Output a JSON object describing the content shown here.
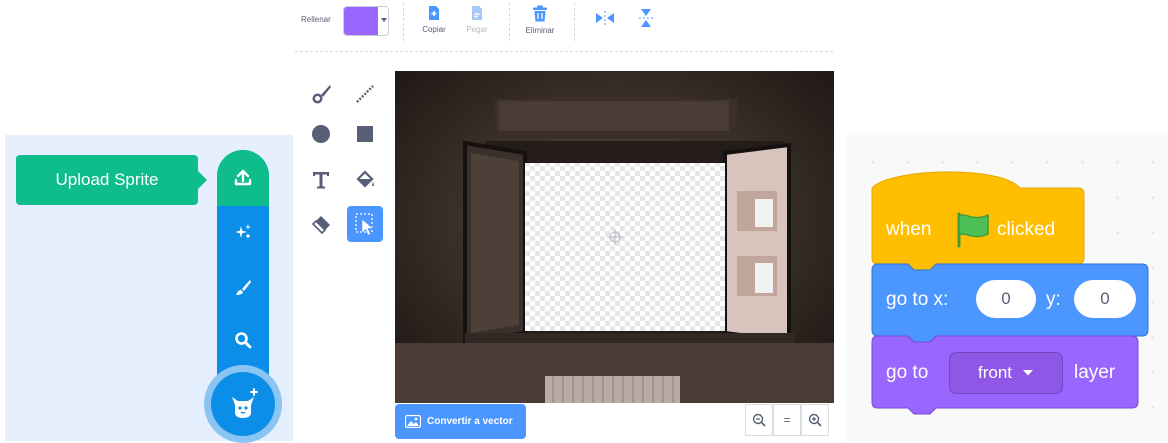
{
  "sprite_menu": {
    "tooltip": "Upload Sprite",
    "items": [
      {
        "icon": "upload-icon",
        "label": "Upload Sprite"
      },
      {
        "icon": "surprise-icon"
      },
      {
        "icon": "paint-icon"
      },
      {
        "icon": "search-icon"
      },
      {
        "icon": "cat-icon"
      }
    ],
    "colors": {
      "green": "#0fbd8c",
      "blue": "#0b8ee8",
      "panel": "#e5effd"
    }
  },
  "paint_editor": {
    "fill_label": "Rellenar",
    "fill_color": "#9966ff",
    "toolbar": {
      "copy": "Copiar",
      "paste": "Pegar",
      "delete": "Eliminar"
    },
    "tools": [
      "brush",
      "line",
      "circle",
      "rectangle",
      "text",
      "fill",
      "eraser",
      "select"
    ],
    "selected_tool": "select",
    "convert_button": "Convertir a vector",
    "zoom": {
      "out": "−",
      "reset": "=",
      "in": "+"
    }
  },
  "code": {
    "hat_block": {
      "when": "when",
      "clicked": "clicked"
    },
    "goto_xy": {
      "label": "go to x:",
      "x": "0",
      "y_label": "y:",
      "y": "0"
    },
    "goto_layer": {
      "label": "go to",
      "value": "front",
      "suffix": "layer"
    },
    "colors": {
      "events": "#ffbf00",
      "motion": "#4c97ff",
      "looks": "#9966ff",
      "flag": "#4cbf56"
    }
  }
}
